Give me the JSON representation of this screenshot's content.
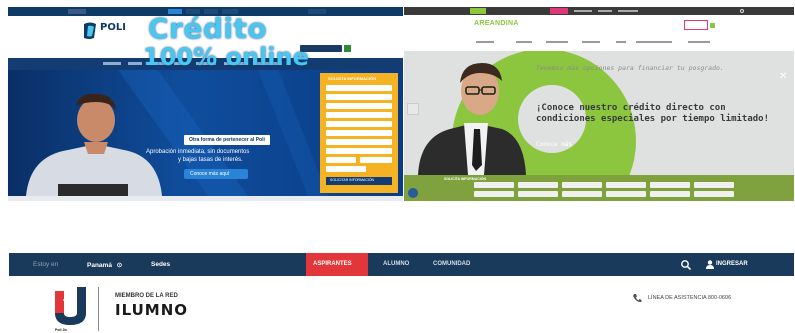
{
  "poli": {
    "logo_text": "POLI",
    "hero_line1": "Crédito",
    "hero_line2": "100% online",
    "hero_tagline": "Otra forma de pertenecer al Poli",
    "hero_desc1": "Aprobación inmediata, sin documentos",
    "hero_desc2": "y bajas tasas de interés.",
    "hero_cta": "Conoce más aquí",
    "form_title": "SOLICITA INFORMACIÓN",
    "form_button": "SOLICITAR INFORMACIÓN",
    "colors": {
      "nav": "#123c72",
      "hero": "#0f4d9c",
      "accent": "#49c7ef",
      "form": "#f5b324"
    }
  },
  "areandina": {
    "logo_text": "AREANDINA",
    "hero_line1": "Tenemos más opciones para financiar tu posgrado.",
    "hero_line2": "¡Conoce nuestro crédito directo con",
    "hero_line3": "condiciones especiales por tiempo limitado!",
    "hero_more": "Conoce más",
    "form_title": "SOLICITA INFORMACIÓN",
    "colors": {
      "brand": "#8cc63f",
      "form": "#7fa13e"
    }
  },
  "topbar": {
    "location_label": "Estoy en",
    "country": "Panamá",
    "sedes": "Sedes",
    "tabs": [
      "ASPIRANTES",
      "ALUMNO",
      "COMUNIDAD"
    ],
    "login": "INGRESAR",
    "active_color": "#e2363a",
    "bar_color": "#193a5a"
  },
  "header": {
    "member_label": "MIEMBRO DE LA RED",
    "network_name": "ILUMNO",
    "phone_label": "LÍNEA DE ASISTENCIA 800-0606"
  }
}
